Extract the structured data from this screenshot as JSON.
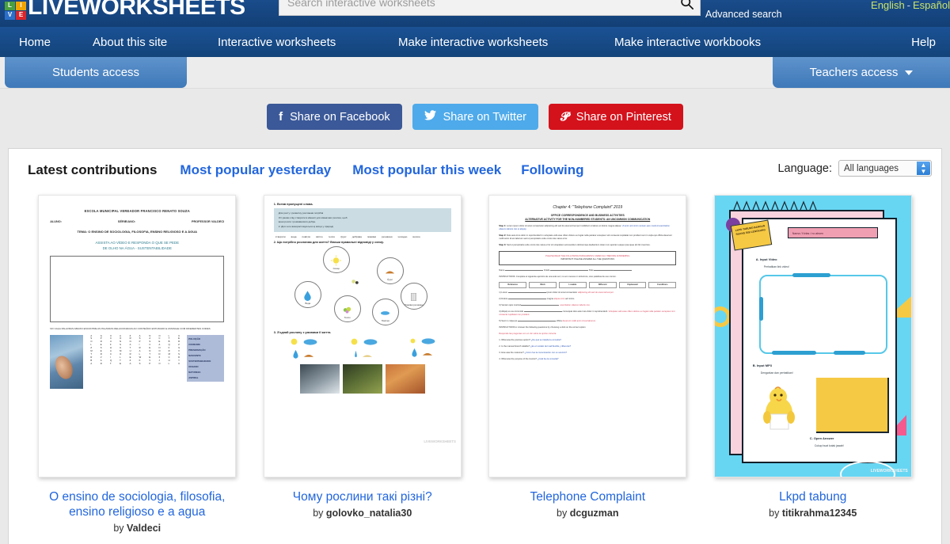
{
  "header": {
    "logo_text": "LIVEWORKSHEETS",
    "logo_squares": [
      {
        "letter": "L",
        "color": "#4aa03f"
      },
      {
        "letter": "I",
        "color": "#f0a500"
      },
      {
        "letter": "V",
        "color": "#2a6fc9"
      },
      {
        "letter": "E",
        "color": "#d9262c"
      }
    ],
    "search": {
      "placeholder": "Search interactive worksheets",
      "value": "",
      "icon": "search-icon"
    },
    "advanced_search": "Advanced search",
    "languages": {
      "english": "English",
      "separator": "-",
      "spanish": "Español"
    }
  },
  "nav": {
    "home": "Home",
    "about": "About this site",
    "interactive_worksheets": "Interactive worksheets",
    "make_interactive_worksheets": "Make interactive worksheets",
    "make_interactive_workbooks": "Make interactive workbooks",
    "help": "Help"
  },
  "access": {
    "students": "Students access",
    "teachers": "Teachers access"
  },
  "share": {
    "facebook": "Share on Facebook",
    "twitter": "Share on Twitter",
    "pinterest": "Share on Pinterest",
    "facebook_color": "#3b5998",
    "twitter_color": "#4eaaea",
    "pinterest_color": "#d4121c"
  },
  "tabs": {
    "latest": "Latest contributions",
    "popular_yesterday": "Most popular yesterday",
    "popular_week": "Most popular this week",
    "following": "Following"
  },
  "language_filter": {
    "label": "Language:",
    "selected": "All languages"
  },
  "cards": [
    {
      "title": "O ensino de sociologia, filosofia, ensino religioso e a agua",
      "by_prefix": "by ",
      "author": "Valdeci",
      "thumb": {
        "header": "ESCOLA MUNICIPAL VEREADOR FRANCISCO RENATO SOUZA",
        "meta_left": "ALUNO:",
        "meta_mid": "SÉRIE/ANO:",
        "meta_right": "PROFESSOR VALDECI",
        "subtitle": "TEMA: O ENSINO DE SOCIOLOGIA, FILOSOFIA, ENSINO RELIGIOSO E A ÁGUA",
        "blue_line_1": "ASSISTA AO VÍDEO E RESPONDA O QUE SE PEDE",
        "blue_line_2": "DE OLHO NA ÁGUA - SUSTENTABILIDADE",
        "note": "NO CAÇA PALAVRAS ABAIXO ENCONTRE AS PALAVRAS RELACIONADAS AO CONTEÚDO ESTUDADO E ASSINALE COM DIFERENTES CORES",
        "word_list": [
          "POLUIÇÃO",
          "CONSUMO",
          "PRESERVAÇÃO",
          "NASCENTE",
          "SUSTENTABILIDADE",
          "OCEANO",
          "NATUREZA",
          "ASPIRAL"
        ],
        "grid": [
          "ASOLZMTRB",
          "GPRESERVA",
          "UCUFHACIQ",
          "AONSUMOLT",
          "ZRNATUREZ",
          "ASPIRALWK",
          "NASCENTEV",
          "OCEANODXJ"
        ]
      }
    },
    {
      "title": "Чому рослини такі різні?",
      "by_prefix": "by ",
      "author": "golovko_natalia30",
      "thumb": {
        "q1": "1. Встав пропущені слова.",
        "panel_lines": [
          "Для росту і розвитку рослинам потрібні",
          "Усі умови слід створити в кімнаті для кімнатних рослин, щоб",
          "вони росли і розвивалися добре.",
          "2. Для чого використовуються ці місця у природі"
        ],
        "word_bank": [
          "створити",
          "вода",
          "повітря",
          "світло",
          "тепло",
          "ґрунт",
          "добрива",
          "поживні",
          "речовини",
          "холодно",
          "вологе"
        ],
        "q2": "2. Що потрібно рослинам для життя? Впиши правильні відповіді у схему.",
        "circle_labels": [
          "Сонце",
          "Ґрунт",
          "Вода",
          "Поживні речовини",
          "Тепло",
          "Повітря"
        ],
        "q3": "3. З'єднай рослину з умовами її життя.",
        "watermark": "LIVEWORKSHEETS"
      }
    },
    {
      "title": "Telephone Complaint",
      "by_prefix": "by ",
      "author": "dcguzman",
      "thumb": {
        "title": "Chapter 4: \"Telephone Complaint\" 2019",
        "sub1": "OFFICE CORRESPONDENCE AND BUSINESS ACTIVITIES",
        "sub2": "ALTERNATIVE ACTIVITY FOR THE NON-NUMBERED STUDENTS: AN UNCOMMON COMMUNICATION",
        "box_line1": "PLEASE READ THE FOLLOWING PARAGRAPHS CAREFULLY BEFORE ANSWERING",
        "box_line2": "IMPORTANT: PLEASE ANSWER ALL THE QUESTIONS",
        "instructions_a": "INSTRUCTIONS: Complete el siguiente ejercicio de una sola vez; no son nuevos ni sinónimos, sino palabras de uso común.",
        "instructions_b": "INSTRUCTIONS A: Answer the following questions by choosing a click on the correct option",
        "table_headers": [
          "Reference",
          "Work",
          "Lovable",
          "Different",
          "Unpleasant",
          "Conditions"
        ],
        "watermark": ""
      }
    },
    {
      "title": "Lkpd tabung",
      "by_prefix": "by ",
      "author": "titikrahma12345",
      "thumb": {
        "sticky_note": "LKPD TABUNG BANGUN RUANG SISI LENGKUNG",
        "name_field": "Nama / Kelas / no absen",
        "section_a": "A. Input Video",
        "section_a_sub": "Perhatikan link video!",
        "section_b": "B. Input MP3",
        "section_b_sub": "Dengarkan dan perhatikan!",
        "section_c": "C. Open Answer",
        "section_c_sub": "Cukup buat kotak jawab!",
        "watermark": "LIVEWORKSHEETS"
      }
    }
  ]
}
